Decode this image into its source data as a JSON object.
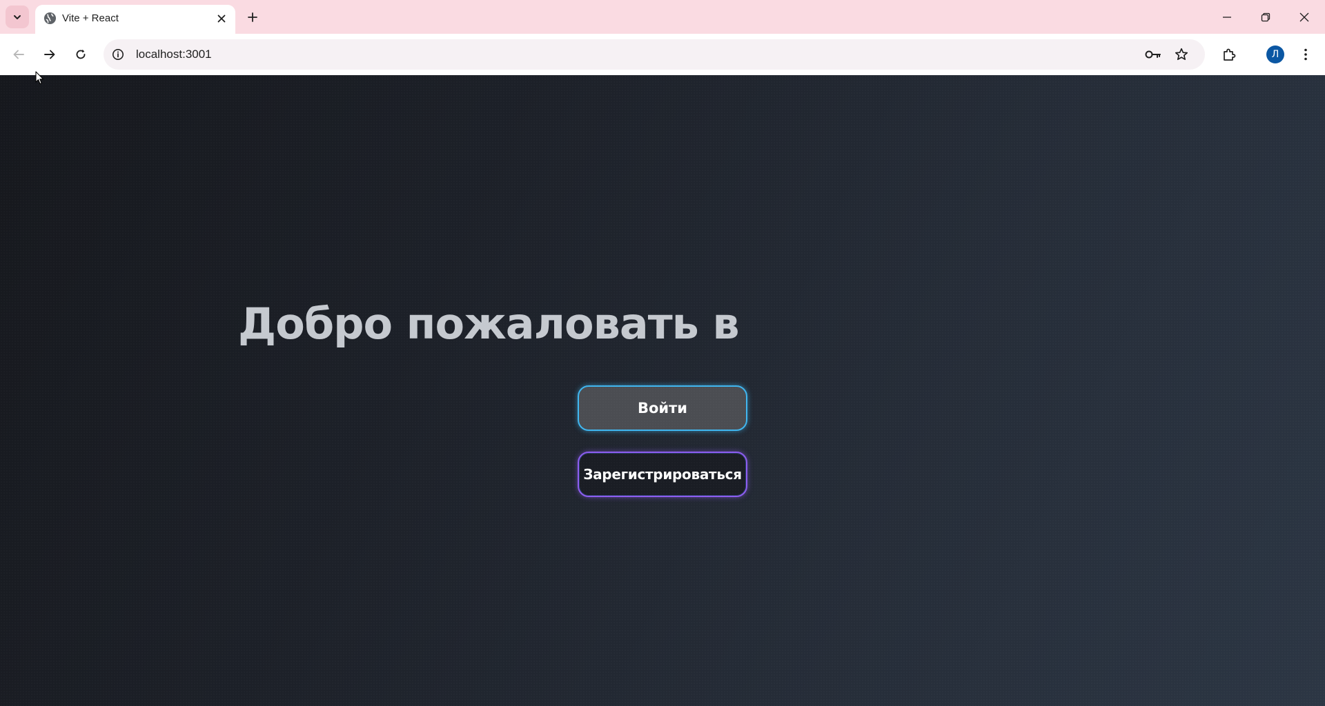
{
  "browser": {
    "tab": {
      "title": "Vite + React",
      "favicon": "globe-icon"
    },
    "address_bar": {
      "url": "localhost:3001"
    },
    "profile_initial": "Л",
    "icons": [
      "tab-search-icon",
      "close-icon",
      "plus-icon",
      "minimize-icon",
      "restore-icon",
      "window-close-icon",
      "back-arrow-icon",
      "forward-arrow-icon",
      "reload-icon",
      "info-icon",
      "key-icon",
      "star-icon",
      "extensions-icon",
      "more-vert-icon"
    ],
    "colors": {
      "tabstrip": "#fadbe2",
      "profile_avatar": "#0b57a3"
    }
  },
  "page": {
    "title": "Добро пожаловать в",
    "buttons": {
      "login": "Войти",
      "register": "Зарегистрироваться"
    },
    "colors": {
      "background_start": "#16181d",
      "background_end": "#2c3644",
      "title": "#c5c9cf",
      "login_border": "#3fb6f0",
      "register_border": "#8d5cf0"
    }
  }
}
